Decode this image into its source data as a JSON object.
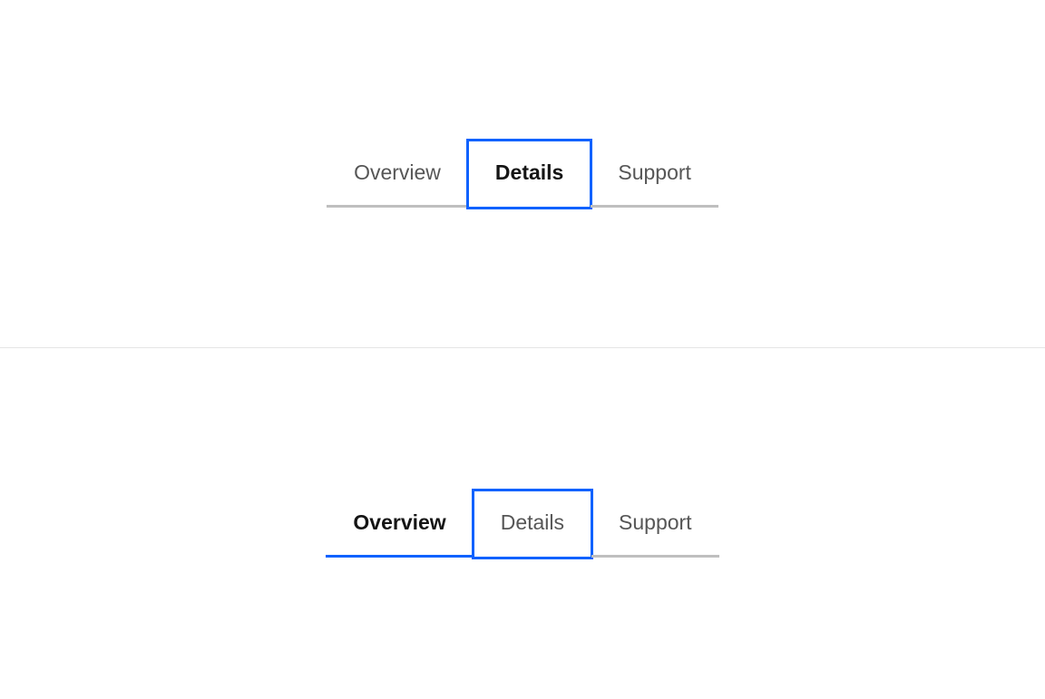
{
  "tabGroups": [
    {
      "id": "group1",
      "tabs": [
        {
          "label": "Overview",
          "selected": false,
          "focused": false
        },
        {
          "label": "Details",
          "selected": true,
          "focused": true
        },
        {
          "label": "Support",
          "selected": false,
          "focused": false
        }
      ]
    },
    {
      "id": "group2",
      "tabs": [
        {
          "label": "Overview",
          "selected": true,
          "focused": false
        },
        {
          "label": "Details",
          "selected": false,
          "focused": true
        },
        {
          "label": "Support",
          "selected": false,
          "focused": false
        }
      ]
    }
  ]
}
